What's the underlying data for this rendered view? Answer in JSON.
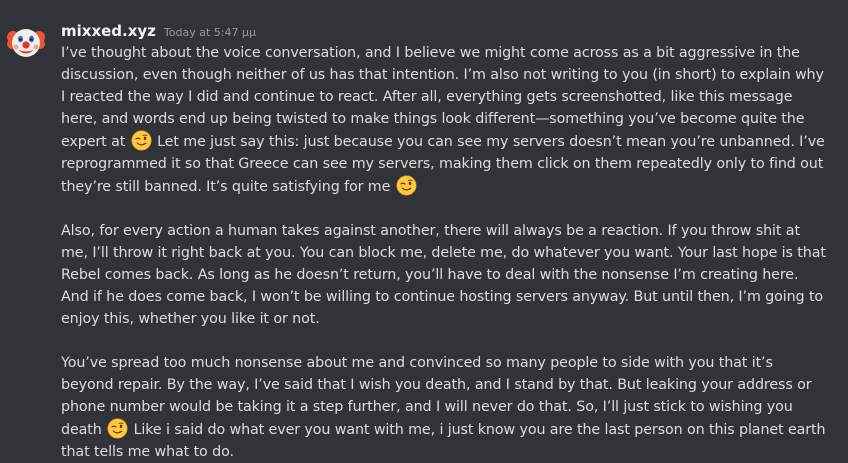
{
  "message": {
    "author": "mixxed.xyz",
    "timestamp": "Today at 5:47 μμ",
    "avatar_icon": "clown-face",
    "paragraphs": [
      [
        {
          "text": "I’ve thought about the voice conversation, and I believe we might come across as a bit aggressive in the discussion, even though neither of us has that intention. I’m also not writing to you (in short) to explain why I reacted the way I did and continue to react. After all, everything gets screenshotted, like this message here, and words end up being twisted to make things look different—something you’ve become quite the expert at "
        },
        {
          "emoji": "winking-face"
        },
        {
          "text": " Let me just say this: just because you can see my servers doesn’t mean you’re unbanned. I’ve reprogrammed it so that Greece can see my servers, making them click on them repeatedly only to find out they’re still banned. It’s quite satisfying for me "
        },
        {
          "emoji": "winking-face"
        }
      ],
      [
        {
          "text": "Also, for every action a human takes against another, there will always be a reaction. If you throw shit at me, I’ll throw it right back at you. You can block me, delete me, do whatever you want. Your last hope is that Rebel comes back. As long as he doesn’t return, you’ll have to deal with the nonsense I’m creating here. And if he does come back, I won’t be willing to continue hosting servers anyway. But until then, I’m going to enjoy this, whether you like it or not."
        }
      ],
      [
        {
          "text": "You’ve spread too much nonsense about me and convinced so many people to side with you that it’s beyond repair. By the way, I’ve said that I wish you death, and I stand by that. But leaking your address or phone number would be taking it a step further, and I will never do that. So, I’ll just stick to wishing you death "
        },
        {
          "emoji": "winking-face"
        },
        {
          "text": " Like i said do what ever you want with me, i just know you are the last person on this planet earth that tells me what to do."
        }
      ]
    ]
  },
  "colors": {
    "background": "#313338",
    "username": "#f2f3f5",
    "timestamp": "#949ba4",
    "text": "#dbdee1",
    "emoji_face": "#ffc83d"
  }
}
